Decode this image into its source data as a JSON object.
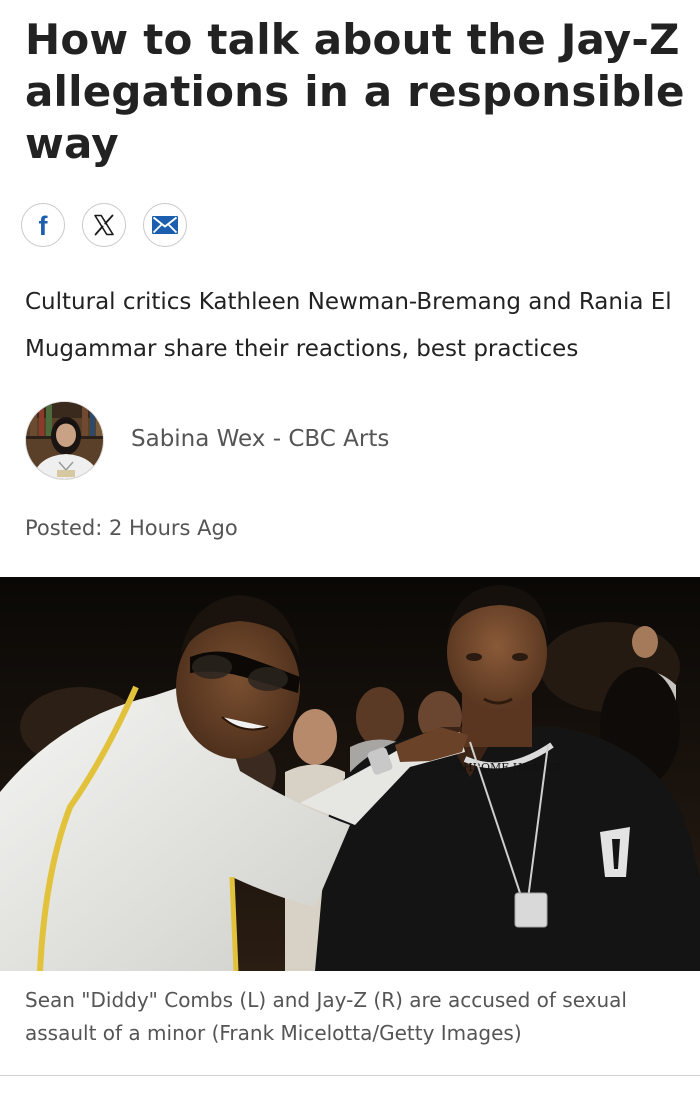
{
  "article": {
    "headline": "How to talk about the Jay-Z allegations in a responsible way",
    "dek": "Cultural critics Kathleen Newman-Bremang and Rania El Mugammar share their reactions, best practices",
    "byline": "Sabina Wex - CBC Arts",
    "posted": "Posted: 2 Hours Ago"
  },
  "share": {
    "facebook_icon": "facebook-icon",
    "x_icon": "x-icon",
    "email_icon": "email-icon",
    "brand_color": "#1c5fae"
  },
  "photo": {
    "caption": "Sean \"Diddy\" Combs (L) and Jay-Z (R) are accused of sexual assault of a minor (Frank Micelotta/Getty Images)",
    "chain_text": "CHROME HEARTS"
  }
}
